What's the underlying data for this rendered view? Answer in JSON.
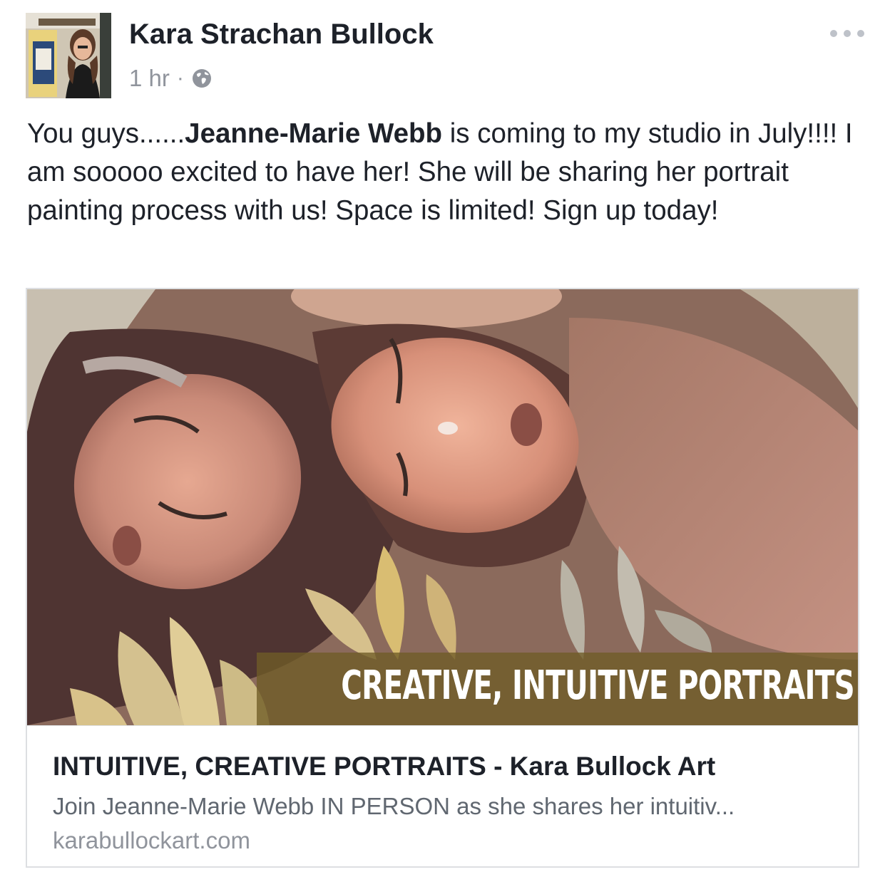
{
  "post": {
    "author": "Kara Strachan Bullock",
    "time": "1 hr",
    "separator": "·",
    "privacy_icon": "globe-icon",
    "more_icon": "more-options-icon",
    "avatar_icon": "profile-photo",
    "text": {
      "part1": "You guys......",
      "mention": "Jeanne-Marie Webb",
      "part2": " is coming to my studio in July!!!!  I am sooooo excited to have her!  She will be sharing her portrait painting process with us!  Space is limited!  Sign up today!"
    }
  },
  "link_card": {
    "image_icon": "painting-image",
    "banner_text": "CREATIVE, INTUITIVE PORTRAITS",
    "title": "INTUITIVE, CREATIVE PORTRAITS - Kara Bullock Art",
    "description": "Join Jeanne-Marie Webb IN PERSON as she shares her intuitiv...",
    "domain": "karabullockart.com"
  },
  "colors": {
    "text": "#1d2129",
    "meta": "#90949c",
    "description": "#606770",
    "border": "#dddfe2",
    "banner": "#705c26"
  }
}
